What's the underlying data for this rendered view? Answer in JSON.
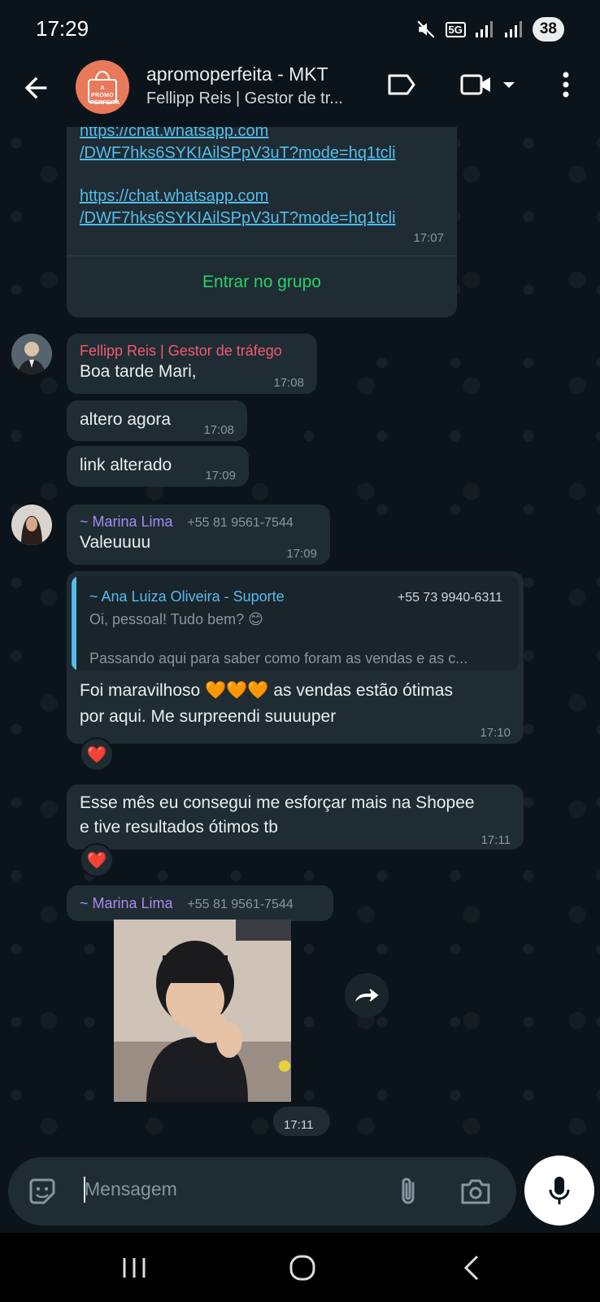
{
  "status_bar": {
    "time": "17:29",
    "network": "5G",
    "battery": "38"
  },
  "header": {
    "avatar_text": "A PROMO PERFEITA",
    "title": "apromoperfeita - MKT",
    "subtitle": "Fellipp Reis | Gestor de tr..."
  },
  "messages": {
    "link_msg": {
      "link1_a": "https://chat.whatsapp.com",
      "link1_b": "/DWF7hks6SYKIAilSPpV3uT?mode=hq1tcli",
      "link2_a": "https://chat.whatsapp.com",
      "link2_b": "/DWF7hks6SYKIAilSPpV3uT?mode=hq1tcli",
      "time": "17:07",
      "join_label": "Entrar no grupo"
    },
    "fellipp_1": {
      "sender": "Fellipp Reis | Gestor de tráfego",
      "text": "Boa tarde Mari,",
      "time": "17:08"
    },
    "fellipp_2": {
      "text": "altero agora",
      "time": "17:08"
    },
    "fellipp_3": {
      "text": "link alterado",
      "time": "17:09"
    },
    "marina_1": {
      "sender": "~ Marina Lima",
      "phone": "+55 81 9561-7544",
      "text": "Valeuuuu",
      "time": "17:09"
    },
    "reply": {
      "quoted_sender": "~ Ana Luiza Oliveira - Suporte",
      "quoted_phone": "+55 73 9940-6311",
      "quoted_line1": "Oi, pessoal! Tudo bem? 😊",
      "quoted_line2": "Passando aqui para saber como foram as vendas e as c...",
      "text_a": "Foi maravilhoso 🧡🧡🧡 as vendas estão ótimas",
      "text_b": "por aqui. Me surpreendi suuuuper",
      "time": "17:10",
      "reaction": "❤️"
    },
    "shopee": {
      "text_a": "Esse mês eu consegui me esforçar mais na Shopee",
      "text_b": "e tive resultados ótimos tb",
      "time": "17:11",
      "reaction": "❤️"
    },
    "sticker": {
      "sender": "~ Marina Lima",
      "phone": "+55 81 9561-7544",
      "time": "17:11"
    }
  },
  "composer": {
    "placeholder": "Mensagem"
  },
  "colors": {
    "accent": "#25d366",
    "bubble": "#202c33",
    "background": "#0b141a",
    "link": "#53bdeb"
  }
}
